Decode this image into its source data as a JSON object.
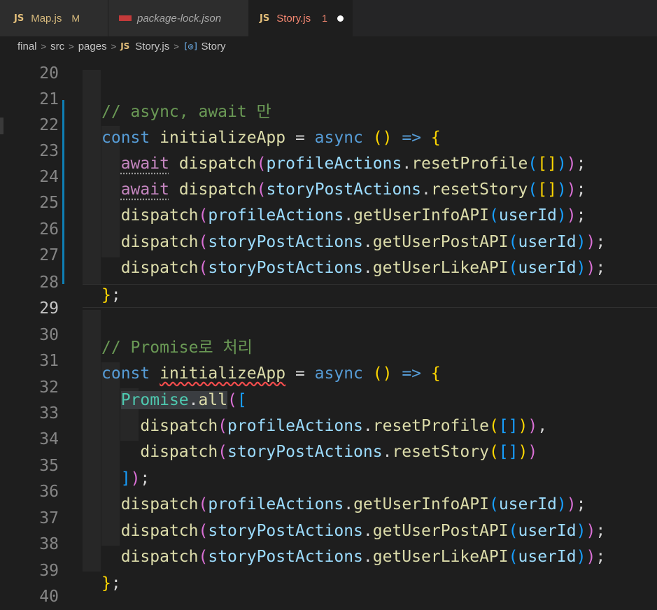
{
  "tabs": [
    {
      "icon": "JS",
      "name": "Map.js",
      "badge": "M"
    },
    {
      "icon": "npm",
      "name": "package-lock.json"
    },
    {
      "icon": "JS",
      "name": "Story.js",
      "badge": "1"
    }
  ],
  "breadcrumb": [
    "final",
    "src",
    "pages",
    "Story.js",
    "Story"
  ],
  "breadcrumb_file_icon": "JS",
  "breadcrumb_symbol_icon": "symbol-variable-icon",
  "line_numbers": [
    "20",
    "21",
    "22",
    "23",
    "24",
    "25",
    "26",
    "27",
    "28",
    "29",
    "30",
    "31",
    "32",
    "33",
    "34",
    "35",
    "36",
    "37",
    "38",
    "39",
    "40"
  ],
  "current_line": "29",
  "code": {
    "l21_comment": "// async, await 만",
    "l30_comment": "// Promise로 처리",
    "kw_const": "const",
    "kw_async": "async",
    "kw_await": "await",
    "fn_name": "initializeApp",
    "eq": " = ",
    "arrow": " => ",
    "open_paren": "(",
    "close_paren": ")",
    "paren_pair": "()",
    "open_brace": "{",
    "close_brace": "}",
    "semi": ";",
    "comma": ",",
    "dot": ".",
    "open_bracket": "[",
    "close_bracket": "]",
    "dispatch": "dispatch",
    "profileActions": "profileActions",
    "storyPostActions": "storyPostActions",
    "resetProfile": "resetProfile",
    "resetStory": "resetStory",
    "getUserInfoAPI": "getUserInfoAPI",
    "getUserPostAPI": "getUserPostAPI",
    "getUserLikeAPI": "getUserLikeAPI",
    "userId": "userId",
    "promise": "Promise",
    "all": "all"
  },
  "colors": {
    "background": "#1e1e1e",
    "keyword": "#569cd6",
    "control": "#c586c0",
    "function": "#dcdcaa",
    "variable": "#9cdcfe",
    "comment": "#6a9955",
    "bracket_1": "#ffd700",
    "bracket_2": "#da70d6",
    "bracket_3": "#179fff"
  }
}
